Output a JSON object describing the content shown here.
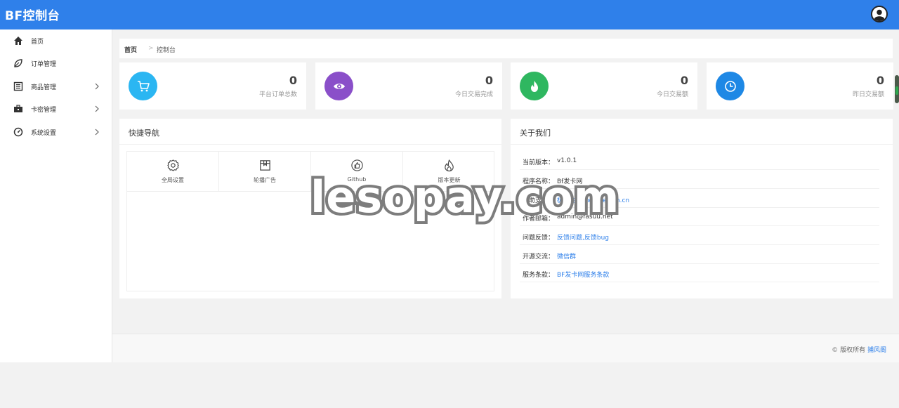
{
  "header": {
    "brand": "BF控制台"
  },
  "sidebar": {
    "items": [
      {
        "label": "首页",
        "icon": "home-icon",
        "expandable": false
      },
      {
        "label": "订单管理",
        "icon": "leaf-icon",
        "expandable": false
      },
      {
        "label": "商品管理",
        "icon": "list-icon",
        "expandable": true
      },
      {
        "label": "卡密管理",
        "icon": "briefcase-icon",
        "expandable": true
      },
      {
        "label": "系统设置",
        "icon": "gauge-icon",
        "expandable": true
      }
    ]
  },
  "breadcrumb": {
    "home": "首页",
    "separator": ">",
    "current": "控制台"
  },
  "stats": [
    {
      "value": "0",
      "label": "平台订单总数",
      "color": "#2bb6f2",
      "icon": "cart-icon"
    },
    {
      "value": "0",
      "label": "今日交易完成",
      "color": "#8a4fc9",
      "icon": "eye-icon"
    },
    {
      "value": "0",
      "label": "今日交易额",
      "color": "#2fb760",
      "icon": "fire-icon"
    },
    {
      "value": "0",
      "label": "昨日交易额",
      "color": "#1e88e5",
      "icon": "clock-icon"
    }
  ],
  "quick_nav": {
    "title": "快捷导航",
    "items": [
      {
        "label": "全局设置",
        "icon": "gear-icon"
      },
      {
        "label": "轮播广告",
        "icon": "box-icon"
      },
      {
        "label": "Github",
        "icon": "thumb-up-icon"
      },
      {
        "label": "版本更新",
        "icon": "flame-icon"
      }
    ]
  },
  "about": {
    "title": "关于我们",
    "rows": [
      {
        "key": "当前版本：",
        "value": "v1.0.1",
        "link": false
      },
      {
        "key": "程序名称：",
        "value": "Bf发卡网",
        "link": false
      },
      {
        "key": "赞助支持：",
        "value": "极云主机www.zeiyun.cn",
        "link": true
      },
      {
        "key": "作者邮箱：",
        "value": "admin@fasuu.net",
        "link": false
      },
      {
        "key": "问题反馈：",
        "value": "反馈问题,反馈bug",
        "link": true
      },
      {
        "key": "开源交流：",
        "value": "微信群",
        "link": true
      },
      {
        "key": "服务条款：",
        "value": "BF发卡网服务条款",
        "link": true
      }
    ]
  },
  "footer": {
    "text": "© 版权所有",
    "link": "捕风阁"
  },
  "watermark": "lesopay.com",
  "colors": {
    "primary": "#2f80ea",
    "link": "#2f80ea"
  }
}
